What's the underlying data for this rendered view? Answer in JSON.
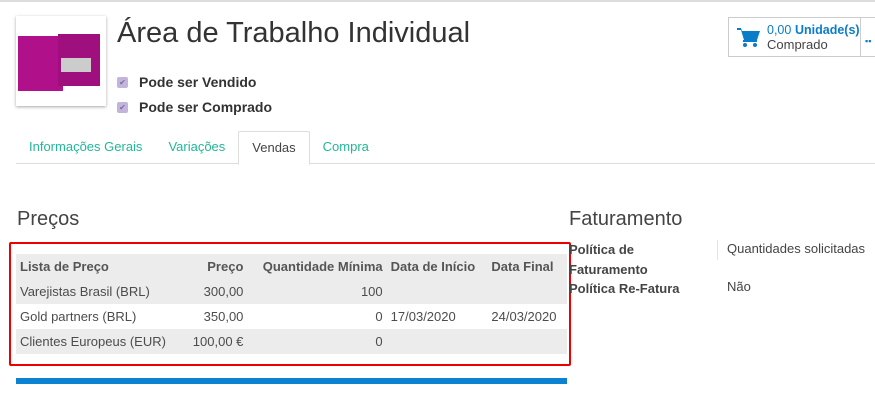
{
  "product": {
    "title": "Área de Trabalho Individual",
    "checkboxes": [
      {
        "label": "Pode ser Vendido",
        "checked": true
      },
      {
        "label": "Pode ser Comprado",
        "checked": true
      }
    ]
  },
  "stat_button": {
    "value": "0,00",
    "unit": "Unidade(s)",
    "label": "Comprado"
  },
  "tabs": [
    {
      "label": "Informações Gerais"
    },
    {
      "label": "Variações"
    },
    {
      "label": "Vendas",
      "active": true
    },
    {
      "label": "Compra"
    }
  ],
  "prices": {
    "title": "Preços",
    "headers": [
      "Lista de Preço",
      "Preço",
      "Quantidade Mínima",
      "Data de Início",
      "Data Final"
    ],
    "rows": [
      [
        "Varejistas Brasil (BRL)",
        "300,00",
        "100",
        "",
        ""
      ],
      [
        "Gold partners (BRL)",
        "350,00",
        "0",
        "17/03/2020",
        "24/03/2020"
      ],
      [
        "Clientes Europeus (EUR)",
        "100,00 €",
        "0",
        "",
        ""
      ]
    ]
  },
  "invoicing": {
    "title": "Faturamento",
    "fields": [
      {
        "label": "Política de Faturamento",
        "value": "Quantidades solicitadas"
      },
      {
        "label": "Política Re-Fatura",
        "value": "Não"
      }
    ]
  }
}
